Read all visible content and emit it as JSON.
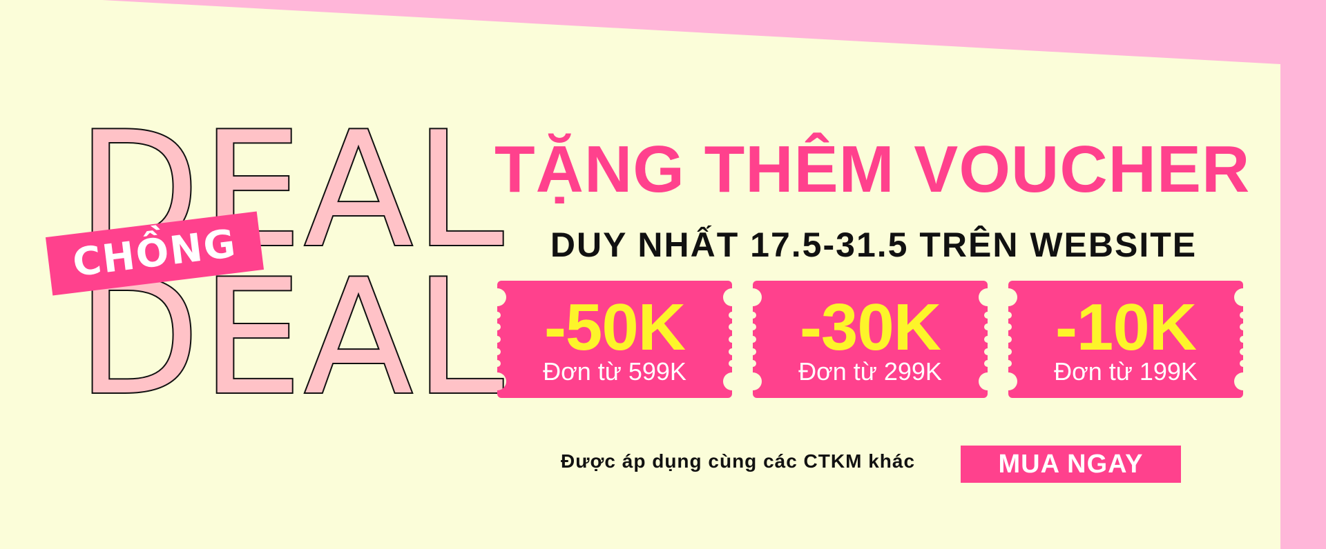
{
  "colors": {
    "accent": "#ff418d",
    "panel": "#fbfdd9",
    "outer": "#ffb6d9",
    "deal_fill": "#ffc2c7",
    "amount": "#fdf42a"
  },
  "brand": {
    "deal_top": "DEAL",
    "chong": "CHỒNG",
    "deal_bottom": "DEAL"
  },
  "headline": "TẶNG THÊM VOUCHER",
  "subheadline": "DUY NHẤT 17.5-31.5 TRÊN WEBSITE",
  "vouchers": [
    {
      "amount": "-50K",
      "condition": "Đơn từ 599K"
    },
    {
      "amount": "-30K",
      "condition": "Đơn từ 299K"
    },
    {
      "amount": "-10K",
      "condition": "Đơn từ 199K"
    }
  ],
  "note": "Được áp dụng cùng các CTKM khác",
  "cta_label": "MUA NGAY"
}
